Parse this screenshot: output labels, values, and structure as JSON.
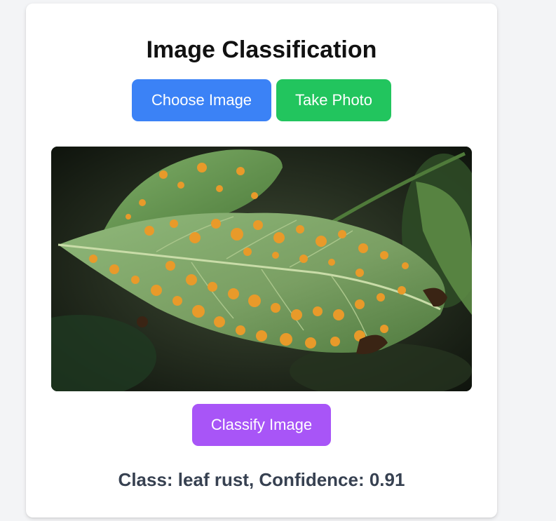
{
  "page": {
    "title": "Image Classification",
    "background_color": "#f3f4f6"
  },
  "buttons": {
    "choose_label": "Choose Image",
    "choose_color": "#3b82f6",
    "take_label": "Take Photo",
    "take_color": "#22c55e",
    "classify_label": "Classify Image",
    "classify_color": "#a855f7"
  },
  "preview": {
    "subject": "coffee leaf with orange rust spots",
    "leaf_color": "#7fa66a",
    "spot_color": "#e89a2a",
    "background_color": "#1c2418"
  },
  "result": {
    "text": "Class: leaf rust, Confidence: 0.91"
  }
}
